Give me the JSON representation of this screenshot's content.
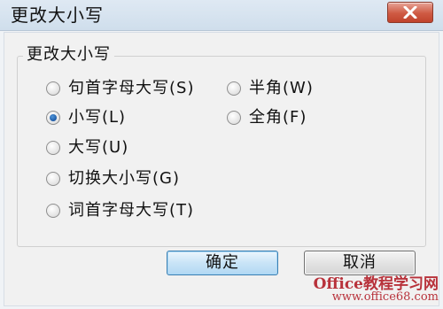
{
  "window": {
    "title": "更改大小写",
    "close_icon": "close-icon"
  },
  "group": {
    "legend": "更改大小写",
    "options": [
      {
        "label": "句首字母大写(S)",
        "checked": false
      },
      {
        "label": "小写(L)",
        "checked": true
      },
      {
        "label": "大写(U)",
        "checked": false
      },
      {
        "label": "切换大小写(G)",
        "checked": false
      },
      {
        "label": "词首字母大写(T)",
        "checked": false
      },
      {
        "label": "半角(W)",
        "checked": false
      },
      {
        "label": "全角(F)",
        "checked": false
      }
    ]
  },
  "buttons": {
    "ok": "确定",
    "cancel": "取消"
  },
  "watermark": {
    "line1": "Office教程学习网",
    "line2": "www.office68.com"
  },
  "colors": {
    "title_bar": "#d5e3f0",
    "close_button": "#c94a34",
    "ok_border": "#3c7fb1",
    "watermark": "#b8323b"
  }
}
